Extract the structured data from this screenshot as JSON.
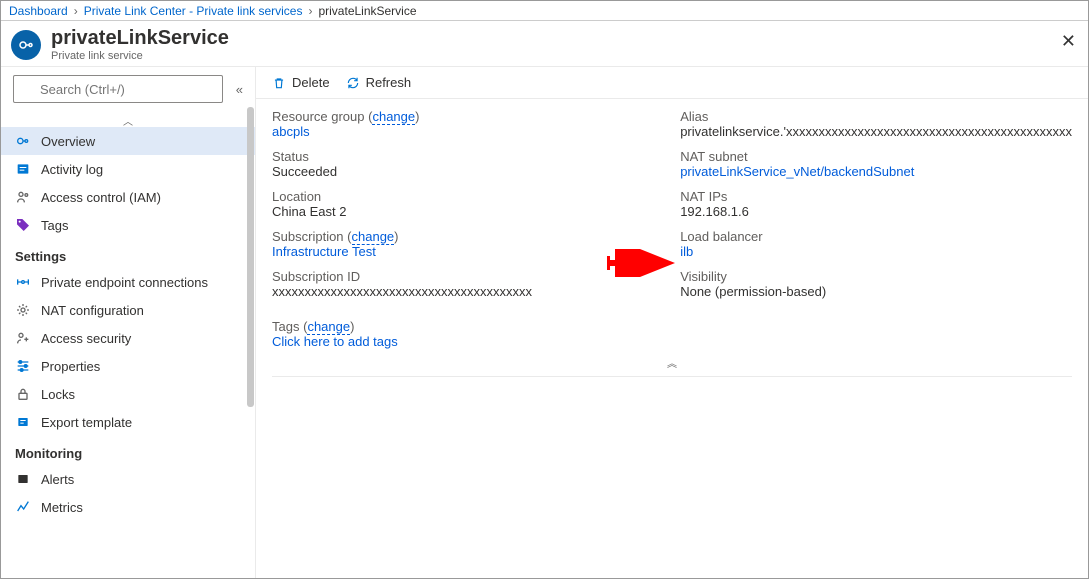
{
  "breadcrumb": {
    "a": "Dashboard",
    "b": "Private Link Center - Private link services",
    "c": "privateLinkService"
  },
  "header": {
    "title": "privateLinkService",
    "subtitle": "Private link service"
  },
  "search": {
    "placeholder": "Search (Ctrl+/)"
  },
  "side": {
    "main": [
      {
        "label": "Overview",
        "icon": "overview",
        "active": true
      },
      {
        "label": "Activity log",
        "icon": "log"
      },
      {
        "label": "Access control (IAM)",
        "icon": "iam"
      },
      {
        "label": "Tags",
        "icon": "tags"
      }
    ],
    "settings_label": "Settings",
    "settings": [
      {
        "label": "Private endpoint connections",
        "icon": "pec"
      },
      {
        "label": "NAT configuration",
        "icon": "nat"
      },
      {
        "label": "Access security",
        "icon": "acc"
      },
      {
        "label": "Properties",
        "icon": "prop"
      },
      {
        "label": "Locks",
        "icon": "lock"
      },
      {
        "label": "Export template",
        "icon": "export"
      }
    ],
    "monitoring_label": "Monitoring",
    "monitoring": [
      {
        "label": "Alerts",
        "icon": "alert"
      },
      {
        "label": "Metrics",
        "icon": "metrics"
      }
    ]
  },
  "toolbar": {
    "delete": "Delete",
    "refresh": "Refresh"
  },
  "overview": {
    "left": {
      "rg_label": "Resource group",
      "rg_change": "change",
      "rg_value": "abcpls",
      "status_label": "Status",
      "status_value": "Succeeded",
      "location_label": "Location",
      "location_value": "China East 2",
      "sub_label": "Subscription",
      "sub_change": "change",
      "sub_value": "Infrastructure Test",
      "subid_label": "Subscription ID",
      "subid_value": "xxxxxxxxxxxxxxxxxxxxxxxxxxxxxxxxxxxxxxxx",
      "tags_label": "Tags",
      "tags_change": "change",
      "tags_value": "Click here to add tags"
    },
    "right": {
      "alias_label": "Alias",
      "alias_value": "privatelinkservice.'xxxxxxxxxxxxxxxxxxxxxxxxxxxxxxxxxxxxxxxxxxxx",
      "nat_label": "NAT subnet",
      "nat_value": "privateLinkService_vNet/backendSubnet",
      "natip_label": "NAT IPs",
      "natip_value": "192.168.1.6",
      "lb_label": "Load balancer",
      "lb_value": "ilb",
      "vis_label": "Visibility",
      "vis_value": "None (permission-based)"
    }
  },
  "arrow_color": "#ff0000"
}
